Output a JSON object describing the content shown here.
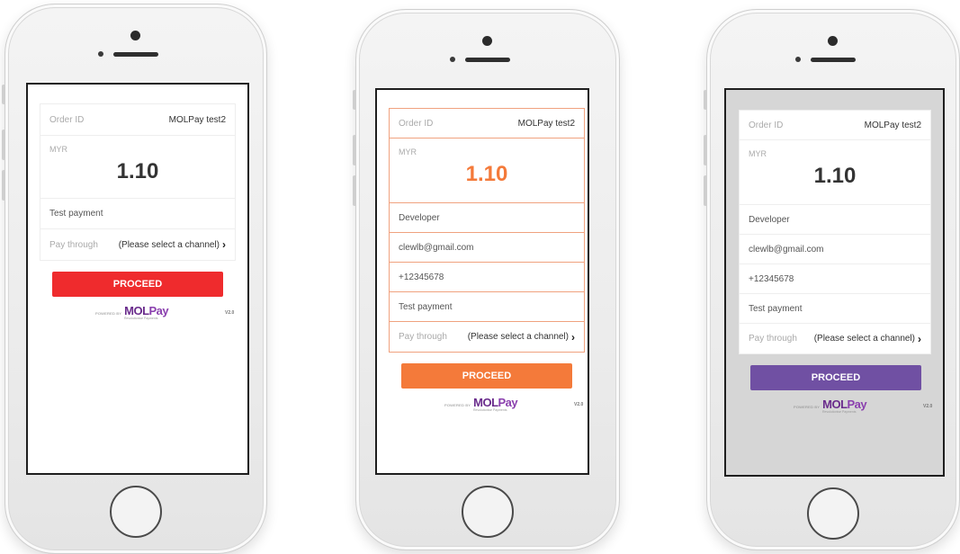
{
  "phones": [
    {
      "screen_bg": "#ffffff",
      "row_border": "#eeeeee",
      "accent": "#ef2b2d",
      "order_label": "Order ID",
      "order_value": "MOLPay test2",
      "currency": "MYR",
      "amount": "1.10",
      "amount_color": "#333333",
      "rows": [
        "Test payment"
      ],
      "pay_label": "Pay through",
      "pay_value": "(Please select a channel)",
      "proceed_label": "PROCEED",
      "powered_by": "POWERED BY",
      "brand_mol": "MOL",
      "brand_pay": "Pay",
      "tagline": "Revolutionise Payments",
      "version": "V2.0"
    },
    {
      "screen_bg": "#ffffff",
      "row_border": "#f0a27f",
      "accent": "#f47a3a",
      "order_label": "Order ID",
      "order_value": "MOLPay test2",
      "currency": "MYR",
      "amount": "1.10",
      "amount_color": "#f47a3a",
      "rows": [
        "Developer",
        "clewlb@gmail.com",
        "+12345678",
        "Test payment"
      ],
      "pay_label": "Pay through",
      "pay_value": "(Please select a channel)",
      "proceed_label": "PROCEED",
      "powered_by": "POWERED BY",
      "brand_mol": "MOL",
      "brand_pay": "Pay",
      "tagline": "Revolutionise Payments",
      "version": "V2.0"
    },
    {
      "screen_bg": "#d6d6d6",
      "row_border": "#eeeeee",
      "accent": "#7050a3",
      "order_label": "Order ID",
      "order_value": "MOLPay test2",
      "currency": "MYR",
      "amount": "1.10",
      "amount_color": "#333333",
      "rows": [
        "Developer",
        "clewlb@gmail.com",
        "+12345678",
        "Test payment"
      ],
      "pay_label": "Pay through",
      "pay_value": "(Please select a channel)",
      "proceed_label": "PROCEED",
      "powered_by": "POWERED BY",
      "brand_mol": "MOL",
      "brand_pay": "Pay",
      "tagline": "Revolutionise Payments",
      "version": "V2.0"
    }
  ]
}
